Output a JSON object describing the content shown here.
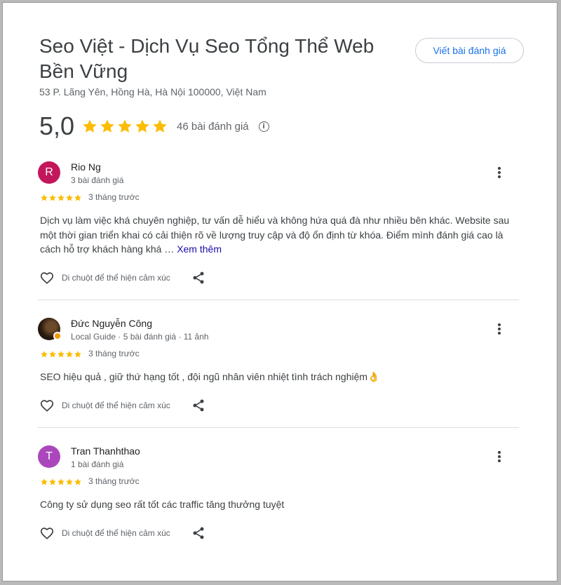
{
  "business": {
    "title": "Seo Việt - Dịch Vụ Seo Tổng Thể Web Bền Vững",
    "address": "53 P. Lãng Yên, Hồng Hà, Hà Nội 100000, Việt Nam",
    "write_review_label": "Viết bài đánh giá",
    "rating": "5,0",
    "stars": 5,
    "review_count": "46 bài đánh giá",
    "info_glyph": "i"
  },
  "colors": {
    "star": "#fbbc04",
    "link": "#1a73e8"
  },
  "reviews": [
    {
      "initial": "R",
      "avatar_color": "#c2185b",
      "name": "Rio Ng",
      "meta": "3 bài đánh giá",
      "stars": 5,
      "date": "3 tháng trước",
      "text": "Dịch vụ làm việc khá chuyên nghiệp, tư vấn dễ hiểu và không hứa quá đà như nhiều bên khác. Website sau một thời gian triển khai có cải thiện rõ về lượng truy cập và độ ổn định từ khóa. Điểm mình đánh giá cao là cách hỗ trợ khách hàng khá …",
      "see_more": "Xem thêm",
      "reaction_label": "Di chuột để thể hiện cảm xúc"
    },
    {
      "initial": "",
      "avatar_color": "#2a1a0e",
      "name": "Đức Nguyễn Công",
      "meta": "Local Guide · 5 bài đánh giá · 11 ảnh",
      "stars": 5,
      "date": "3 tháng trước",
      "text": "SEO hiệu quả , giữ thứ hạng tốt , đội ngũ nhân viên nhiệt tình trách nghiệm👌",
      "see_more": "",
      "reaction_label": "Di chuột để thể hiện cảm xúc"
    },
    {
      "initial": "T",
      "avatar_color": "#ab47bc",
      "name": "Tran Thanhthao",
      "meta": "1 bài đánh giá",
      "stars": 5,
      "date": "3 tháng trước",
      "text": "Công ty sử dụng seo rất tốt các traffic tăng thưởng tuyệt",
      "see_more": "",
      "reaction_label": "Di chuột để thể hiện cảm xúc"
    }
  ],
  "icons": [
    "star-icon",
    "info-icon",
    "more-vert-icon",
    "heart-icon",
    "share-icon",
    "local-guide-badge-icon"
  ]
}
